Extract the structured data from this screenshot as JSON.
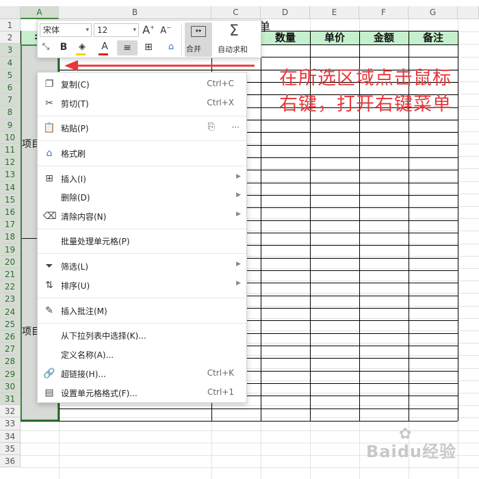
{
  "sheet": {
    "columns": [
      "A",
      "B",
      "C",
      "D",
      "E",
      "F",
      "G"
    ],
    "rows": [
      "1",
      "2",
      "3",
      "4",
      "5",
      "6",
      "7",
      "8",
      "9",
      "10",
      "11",
      "12",
      "13",
      "14",
      "15",
      "16",
      "17",
      "18",
      "19",
      "20",
      "21",
      "22",
      "23",
      "24",
      "25",
      "26",
      "27",
      "28",
      "29",
      "30",
      "31",
      "32",
      "33",
      "34",
      "35",
      "36"
    ],
    "title_fragment": "单",
    "header_partial": "名",
    "headers": [
      "数量",
      "单价",
      "金额",
      "备注"
    ],
    "cell_a10": "项目",
    "cell_a24": "项目"
  },
  "toolbar": {
    "font_name": "宋体",
    "font_size": "12",
    "increase_font": "A",
    "decrease_font": "A",
    "bold": "B",
    "font_color": "A",
    "merge_label": "合并",
    "autosum_label": "自动求和"
  },
  "context_menu": {
    "items": [
      {
        "icon": "copy-icon",
        "label": "复制(C)",
        "shortcut": "Ctrl+C"
      },
      {
        "icon": "cut-icon",
        "label": "剪切(T)",
        "shortcut": "Ctrl+X"
      },
      {
        "icon": "paste-icon",
        "label": "粘贴(P)",
        "extra": "···"
      },
      {
        "icon": "format-painter-icon",
        "label": "格式刷"
      },
      {
        "icon": "insert-icon",
        "label": "插入(I)"
      },
      {
        "icon": "",
        "label": "删除(D)"
      },
      {
        "icon": "eraser-icon",
        "label": "清除内容(N)"
      },
      {
        "icon": "",
        "label": "批量处理单元格(P)"
      },
      {
        "icon": "filter-icon",
        "label": "筛选(L)"
      },
      {
        "icon": "sort-icon",
        "label": "排序(U)"
      },
      {
        "icon": "comment-icon",
        "label": "插入批注(M)"
      },
      {
        "icon": "",
        "label": "从下拉列表中选择(K)..."
      },
      {
        "icon": "",
        "label": "定义名称(A)..."
      },
      {
        "icon": "link-icon",
        "label": "超链接(H)...",
        "shortcut": "Ctrl+K"
      },
      {
        "icon": "cell-format-icon",
        "label": "设置单元格格式(F)...",
        "shortcut": "Ctrl+1"
      }
    ]
  },
  "annotation": {
    "line1": "在所选区域点击鼠标",
    "line2": "右键，打开右键菜单"
  },
  "watermark": "Baidu经验",
  "colors": {
    "accent_green": "#3a8a3a",
    "header_fill": "#c6efce",
    "annotation_red": "#e8383b"
  }
}
